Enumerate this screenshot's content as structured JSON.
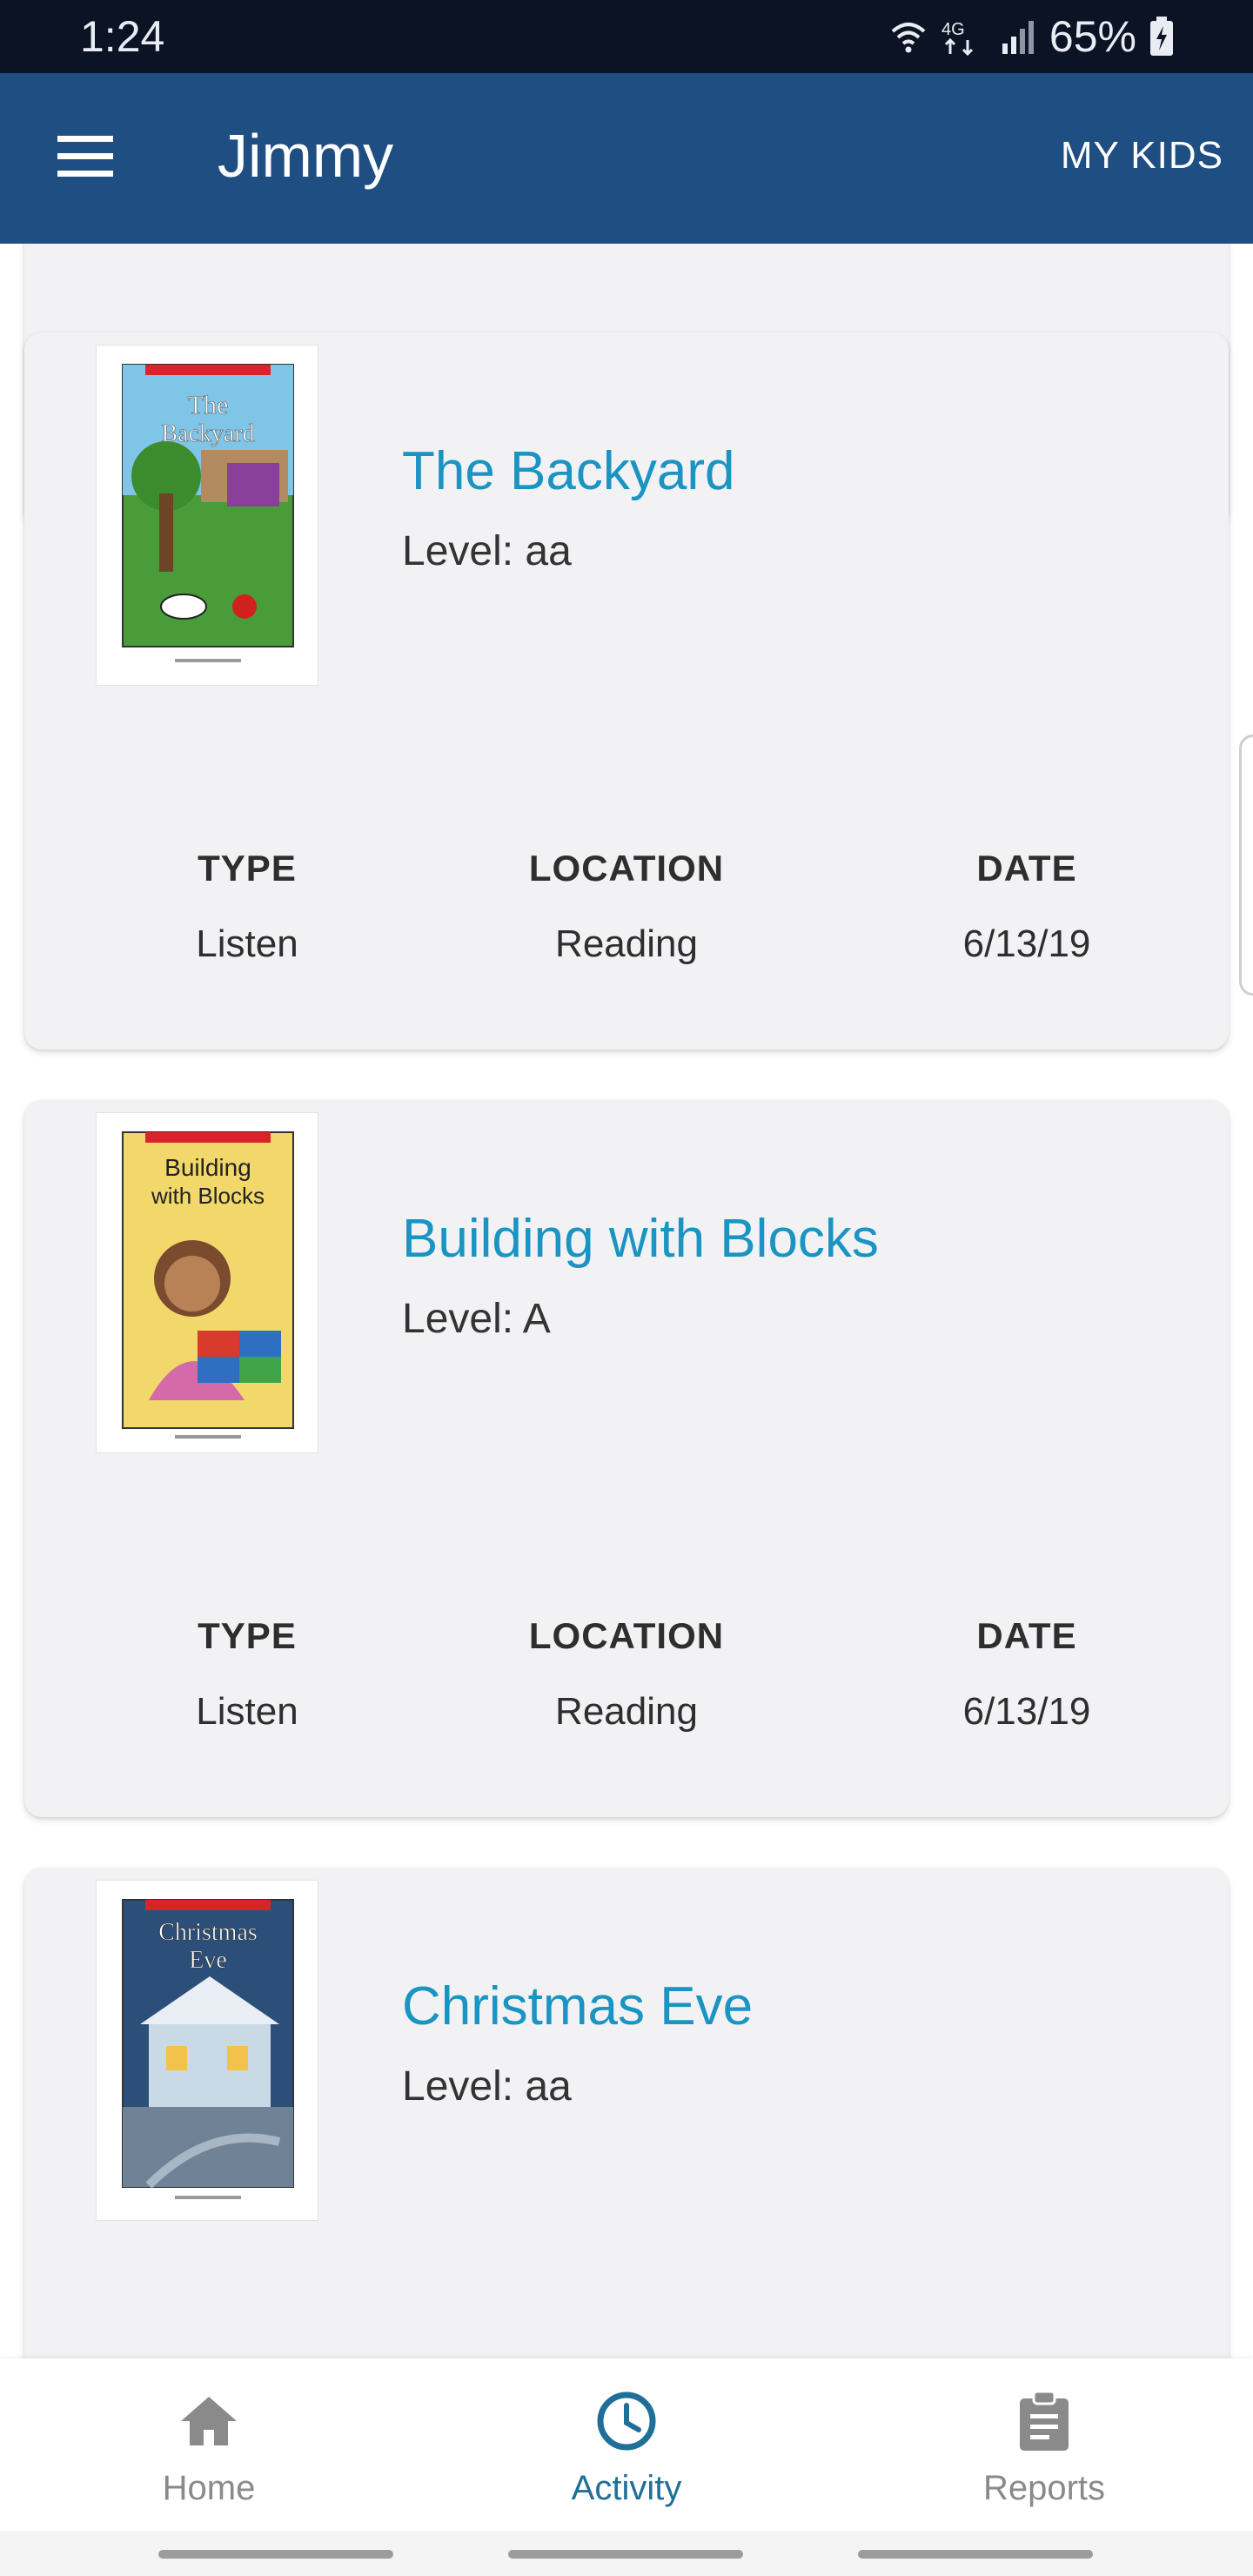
{
  "status_bar": {
    "time": "1:24",
    "network": "4G",
    "battery": "65%"
  },
  "app_bar": {
    "title": "Jimmy",
    "my_kids_label": "MY KIDS",
    "menu_icon": "hamburger-menu-icon"
  },
  "meta_labels": {
    "type": "TYPE",
    "location": "LOCATION",
    "date": "DATE"
  },
  "activities": [
    {
      "title": "The Backyard",
      "level": "Level: aa",
      "cover_text": [
        "The",
        "Backyard"
      ],
      "type": "Listen",
      "location": "Reading",
      "date": "6/13/19"
    },
    {
      "title": "Building with Blocks",
      "level": "Level: A",
      "cover_text": [
        "Building",
        "with Blocks"
      ],
      "type": "Listen",
      "location": "Reading",
      "date": "6/13/19"
    },
    {
      "title": "Christmas Eve",
      "level": "Level: aa",
      "cover_text": [
        "Christmas",
        "Eve"
      ]
    }
  ],
  "bottom_nav": {
    "items": [
      {
        "label": "Home",
        "icon": "home-icon",
        "active": false
      },
      {
        "label": "Activity",
        "icon": "clock-icon",
        "active": true
      },
      {
        "label": "Reports",
        "icon": "clipboard-icon",
        "active": false
      }
    ]
  },
  "colors": {
    "app_bar": "#1f4e82",
    "status_bar": "#0b1324",
    "book_title": "#1a94c2",
    "active_nav": "#1f6f99",
    "inactive_nav": "#8a8a8a",
    "card_bg": "#f2f2f4"
  }
}
